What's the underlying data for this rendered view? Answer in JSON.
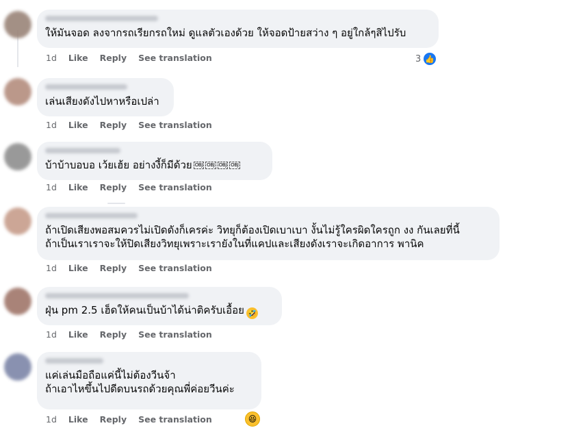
{
  "comments": [
    {
      "text": "ให้มันจอด ลงจากรถเรียกรถใหม่ ดูแลตัวเองด้วย ให้จอดป้ายสว่าง ๆ อยู่ใกล้ๆสิไปรับ",
      "time": "1d",
      "like": "Like",
      "reply": "Reply",
      "translate": "See translation",
      "reaction_count": "3",
      "reaction_icon": "like-icon",
      "avatar_color": "#9a8478"
    },
    {
      "text": "เล่นเสียงดังไปหาหรือเปล่า",
      "time": "1d",
      "like": "Like",
      "reply": "Reply",
      "translate": "See translation",
      "avatar_color": "#b48d7e"
    },
    {
      "text": "บ้าบ้าบอบอ เว้ยเฮ้ย อย่างงี้ก็มีด้วย",
      "inline_tokens": [
        "OBJ",
        "OBJ",
        "OBJ",
        "OBJ"
      ],
      "time": "1d",
      "like": "Like",
      "reply": "Reply",
      "translate": "See translation",
      "avatar_color": "#8f8f8f"
    },
    {
      "text_line1": "ถ้าเปิดเสียงพอสมควรไม่เปิดดังก็เครค่ะ วิทยุก็ต้องเปิดเบาเบา งั้นไม่รู้ใครผิดใครถูก งง กันเลยที่นี้",
      "text_line2": "ถ้าเป็นเราเราจะให้ปิดเสียงวิทยุเพราะเรายังในที่แคปและเสียงดังเราจะเกิดอาการ พานิค",
      "time": "1d",
      "like": "Like",
      "reply": "Reply",
      "translate": "See translation",
      "avatar_color": "#c79d8b"
    },
    {
      "text": "ฝุ่น pm 2.5 เฮ็ดให้คนเป็นบ้าได้น่าติครับเอื้อย",
      "inline_emoji": "rolling-laughing-emoji",
      "time": "1d",
      "like": "Like",
      "reply": "Reply",
      "translate": "See translation",
      "avatar_color": "#a0766a"
    },
    {
      "text_line1": "แค่เล่นมือถือแค่นี้ไม่ต้องวีนจ้า",
      "text_line2": "ถ้าเอาไหขึ้นไปดีดบนรถด้วยคุณพี่ค่อยวีนค่ะ",
      "time": "1d",
      "like": "Like",
      "reply": "Reply",
      "translate": "See translation",
      "reaction_icon": "haha-icon",
      "avatar_color": "#7d86a8"
    }
  ]
}
